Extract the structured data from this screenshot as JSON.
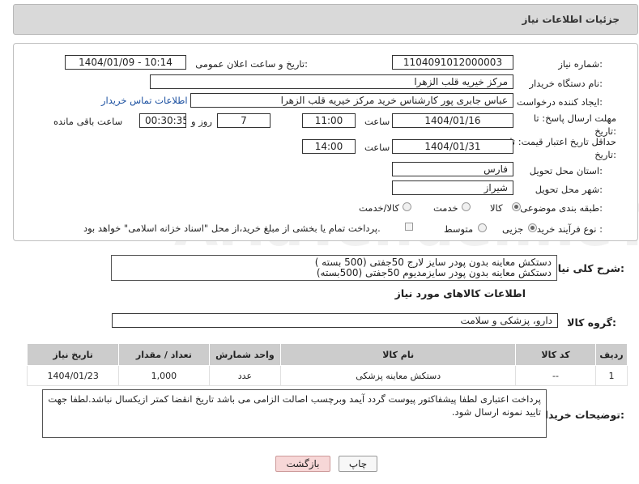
{
  "header": {
    "title": "جزئیات اطلاعات نیاز"
  },
  "form": {
    "need_number_label": "شماره نیاز:",
    "need_number": "1104091012000003",
    "announce_label": "تاریخ و ساعت اعلان عمومی:",
    "announce_value": "1404/01/09 - 10:14",
    "buyer_org_label": "نام دستگاه خریدار:",
    "buyer_org": "مرکز خیریه قلب الزهرا",
    "creator_label": "ایجاد کننده درخواست:",
    "creator": "عباس جابری پور کارشناس خرید مرکز خیریه قلب الزهرا",
    "contact_link": "اطلاعات تماس خریدار",
    "reply_deadline_label": "مهلت ارسال پاسخ: تا تاریخ:",
    "reply_date": "1404/01/16",
    "time_label": "ساعت",
    "reply_time": "11:00",
    "days_value": "7",
    "days_label": "روز و",
    "remaining_time": "00:30:35",
    "remaining_label": "ساعت باقی مانده",
    "price_validity_label": "حداقل تاریخ اعتبار قیمت: تا تاریخ:",
    "price_date": "1404/01/31",
    "price_time": "14:00",
    "province_label": "استان محل تحویل:",
    "province": "فارس",
    "city_label": "شهر محل تحویل:",
    "city": "شیراز",
    "category_label": "طبقه بندی موضوعی:",
    "category_options": [
      "کالا",
      "خدمت",
      "کالا/خدمت"
    ],
    "process_label": "نوع فرآیند خرید :",
    "process_options": [
      "جزیی",
      "متوسط"
    ],
    "payment_note": "پرداخت تمام یا بخشی از مبلغ خرید،از محل \"اسناد خزانه اسلامی\" خواهد بود."
  },
  "summary": {
    "label": "شرح کلی نیاز:",
    "line1": "دستکش معاینه بدون پودر سایز لارج 50جفتی  (500 بسته )",
    "line2": "دستکش معاینه بدون پودر سایزمدیوم 50جفتی   (500بسته)"
  },
  "goods_info_title": "اطلاعات کالاهای مورد نیاز",
  "goods_group": {
    "label": "گروه کالا:",
    "value": "دارو، پزشکی و سلامت"
  },
  "table": {
    "headers": [
      "ردیف",
      "کد کالا",
      "نام کالا",
      "واحد شمارش",
      "تعداد / مقدار",
      "تاریخ نیاز"
    ],
    "rows": [
      [
        "1",
        "--",
        "دستکش معاینه پزشکی",
        "عدد",
        "1,000",
        "1404/01/23"
      ]
    ]
  },
  "buyer_notes": {
    "label": "توضیحات خریدار:",
    "text": "پرداخت اعتباری لطفا پیشفاکتور پیوست گردد آیمد وبرچسب اصالت الزامی می باشد تاریخ انقضا کمتر ازیکسال نباشد.لطفا جهت تایید نمونه ارسال شود."
  },
  "buttons": {
    "print": "چاپ",
    "back": "بازگشت"
  },
  "watermark": "AriaTender.neT",
  "colors": {
    "back_button_bg": "#f7d7d7",
    "header_bg": "#cccccc",
    "link": "#1a4fa0"
  }
}
